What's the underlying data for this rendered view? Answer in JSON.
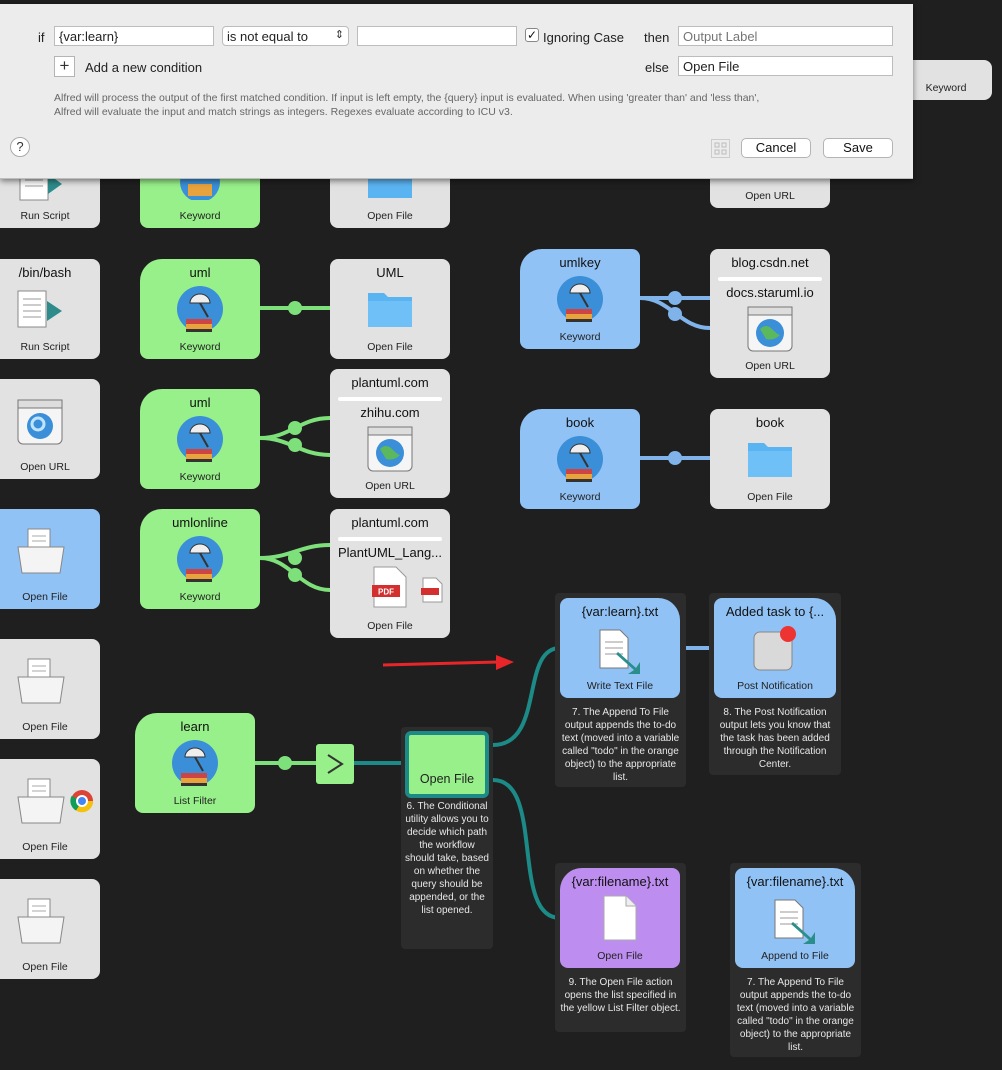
{
  "dialog": {
    "if_label": "if",
    "variable_value": "{var:learn}",
    "operator_value": "is not equal to",
    "compare_value": "",
    "ignoring_case_label": "Ignoring Case",
    "ignoring_case_checked": true,
    "then_label": "then",
    "output_label_placeholder": "Output Label",
    "else_label": "else",
    "else_value": "Open File",
    "add_condition_label": "Add a new condition",
    "help_text_line1": "Alfred will process the output of the first matched condition. If input is left empty, the {query} input is evaluated. When using 'greater than' and 'less than',",
    "help_text_line2": "Alfred will evaluate the input and match strings as integers. Regexes evaluate according to ICU v3.",
    "help_button": "?",
    "cancel_label": "Cancel",
    "save_label": "Save"
  },
  "left_column": {
    "run_script_1": {
      "sub": "Run Script"
    },
    "run_script_2": {
      "title": "/bin/bash",
      "sub": "Run Script"
    },
    "open_url": {
      "sub": "Open URL"
    },
    "open_file_blue": {
      "sub": "Open File"
    },
    "open_file_2": {
      "sub": "Open File"
    },
    "open_file_3": {
      "sub": "Open File"
    },
    "open_file_4": {
      "sub": "Open File"
    }
  },
  "keywords": {
    "kw_top": {
      "sub": "Keyword"
    },
    "kw_uml1": {
      "title": "uml",
      "sub": "Keyword"
    },
    "kw_uml2": {
      "title": "uml",
      "sub": "Keyword"
    },
    "kw_umlonline": {
      "title": "umlonline",
      "sub": "Keyword"
    },
    "kw_umlkey": {
      "title": "umlkey",
      "sub": "Keyword"
    },
    "kw_book": {
      "title": "book",
      "sub": "Keyword"
    },
    "kw_topright": {
      "sub": "Keyword"
    }
  },
  "actions": {
    "of_top": {
      "sub": "Open File"
    },
    "of_uml": {
      "title": "UML",
      "sub": "Open File"
    },
    "url_plantuml": {
      "title1": "plantuml.com",
      "title2": "zhihu.com",
      "sub": "Open URL"
    },
    "pl_plantuml": {
      "title1": "plantuml.com",
      "title2": "PlantUML_Lang...",
      "sub": "Open File"
    },
    "url_top_right": {
      "sub": "Open URL"
    },
    "url_blog": {
      "title1": "blog.csdn.net",
      "title2": "docs.staruml.io",
      "sub": "Open URL"
    },
    "of_book": {
      "title": "book",
      "sub": "Open File"
    }
  },
  "workflow": {
    "list_filter": {
      "title": "learn",
      "sub": "List Filter"
    },
    "conditional": {
      "label": "Open File"
    },
    "conditional_note": "6. The Conditional utility allows you to decide which path the workflow should take, based on whether the query should be appended, or the list opened.",
    "write_text": {
      "title": "{var:learn}.txt",
      "sub": "Write Text File"
    },
    "write_text_note": "7. The Append To File output appends the to-do text (moved into a variable called \"todo\" in the orange object) to the appropriate list.",
    "post_notif": {
      "title": "Added task to {...",
      "sub": "Post Notification"
    },
    "post_notif_note": "8. The Post Notification output lets you know that the task has been added through the Notification Center.",
    "open_file_purple": {
      "title": "{var:filename}.txt",
      "sub": "Open File"
    },
    "open_file_purple_note": "9. The Open File action opens the list specified in the yellow List Filter object.",
    "append_file": {
      "title": "{var:filename}.txt",
      "sub": "Append to File"
    },
    "append_file_note": "7. The Append To File output appends the to-do text (moved into a variable called \"todo\" in the orange object) to the appropriate list."
  },
  "colors": {
    "keyword_green": "#98f08a",
    "action_gray": "#e2e2e2",
    "selected_blue": "#91c2f5",
    "purple": "#bd8ef0",
    "teal_connection": "#1c8a86",
    "arrow_red": "#e8262a"
  }
}
